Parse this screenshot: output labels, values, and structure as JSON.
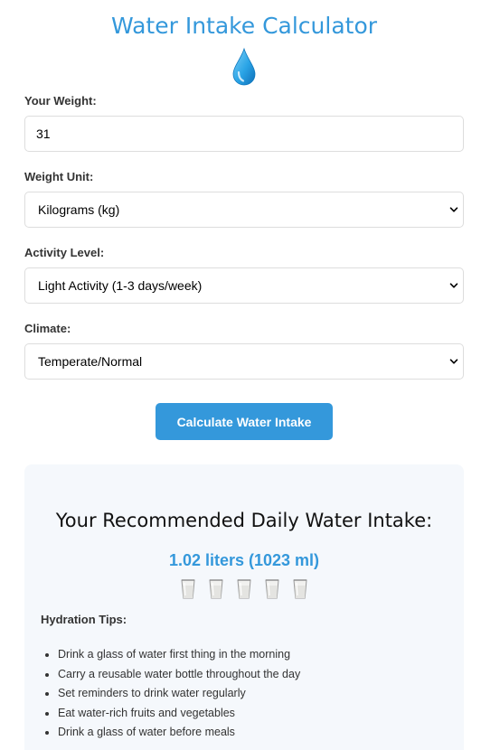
{
  "header": {
    "title": "Water Intake Calculator",
    "icon": "water-drop-icon"
  },
  "form": {
    "weight": {
      "label": "Your Weight:",
      "value": "31"
    },
    "unit": {
      "label": "Weight Unit:",
      "selected": "Kilograms (kg)"
    },
    "activity": {
      "label": "Activity Level:",
      "selected": "Light Activity (1-3 days/week)"
    },
    "climate": {
      "label": "Climate:",
      "selected": "Temperate/Normal"
    },
    "submit_label": "Calculate Water Intake"
  },
  "result": {
    "heading": "Your Recommended Daily Water Intake:",
    "value": "1.02 liters (1023 ml)",
    "glass_count": 5,
    "glass_icon": "glass-icon",
    "tips_title": "Hydration Tips:",
    "tips": [
      "Drink a glass of water first thing in the morning",
      "Carry a reusable water bottle throughout the day",
      "Set reminders to drink water regularly",
      "Eat water-rich fruits and vegetables",
      "Drink a glass of water before meals"
    ]
  },
  "colors": {
    "accent": "#3498db",
    "panel_background": "#f5f8fc",
    "border": "#dddddd"
  }
}
